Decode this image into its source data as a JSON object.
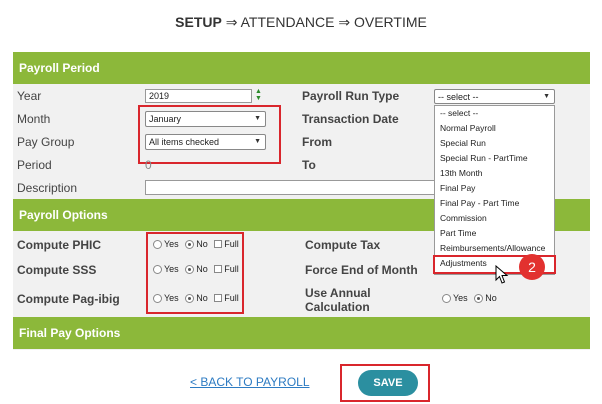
{
  "breadcrumb": {
    "setup": "SETUP",
    "arrow": "⇒",
    "attendance": "ATTENDANCE",
    "overtime": "OVERTIME"
  },
  "sections": {
    "payroll_period": "Payroll Period",
    "payroll_options": "Payroll Options",
    "final_pay_options": "Final Pay Options"
  },
  "labels": {
    "year": "Year",
    "month": "Month",
    "pay_group": "Pay Group",
    "period": "Period",
    "description": "Description",
    "payroll_run_type": "Payroll Run Type",
    "transaction_date": "Transaction Date",
    "from": "From",
    "to": "To",
    "compute_phic": "Compute PHIC",
    "compute_sss": "Compute SSS",
    "compute_pagibig": "Compute Pag-ibig",
    "compute_tax": "Compute Tax",
    "force_end_of_month": "Force End of Month",
    "use_annual_calc_1": "Use Annual",
    "use_annual_calc_2": "Calculation"
  },
  "values": {
    "year": "2019",
    "month": "January",
    "pay_group": "All items checked",
    "period": "0",
    "payroll_run_type": "-- select --"
  },
  "options": {
    "yes": "Yes",
    "no": "No",
    "full": "Full"
  },
  "dropdown": [
    "-- select --",
    "Normal Payroll",
    "Special Run",
    "Special Run - PartTime",
    "13th Month",
    "Final Pay",
    "Final Pay - Part Time",
    "Commission",
    "Part Time",
    "Reimbursements/Allowance",
    "Adjustments"
  ],
  "annotation": {
    "step": "2"
  },
  "actions": {
    "back": "< BACK TO PAYROLL",
    "save": "SAVE"
  },
  "colors": {
    "section_bar": "#8cb83a",
    "highlight": "#d9262c",
    "save_button": "#2b8fa0",
    "link": "#2d7bc2"
  }
}
